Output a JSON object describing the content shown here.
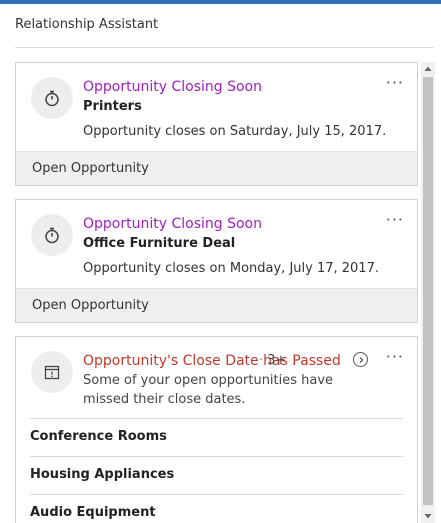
{
  "panel": {
    "title": "Relationship Assistant",
    "accent_color": "#2e6fb5"
  },
  "cards": [
    {
      "icon": "stopwatch-icon",
      "title": "Opportunity Closing Soon",
      "title_color": "#a020c0",
      "subtitle": "Printers",
      "description": "Opportunity closes on Saturday, July 15, 2017.",
      "more": "···",
      "action_label": "Open Opportunity"
    },
    {
      "icon": "stopwatch-icon",
      "title": "Opportunity Closing Soon",
      "title_color": "#a020c0",
      "subtitle": "Office Furniture Deal",
      "description": "Opportunity closes on Monday, July 17, 2017.",
      "more": "···",
      "action_label": "Open Opportunity"
    },
    {
      "icon": "calendar-alert-icon",
      "title": "Opportunity's Close Date has Passed",
      "title_color": "#c0392b",
      "separator": "·",
      "count": "3+",
      "description": "Some of your open opportunities have missed their close dates.",
      "more": "···",
      "items": [
        "Conference Rooms",
        "Housing Appliances",
        "Audio Equipment"
      ]
    }
  ]
}
